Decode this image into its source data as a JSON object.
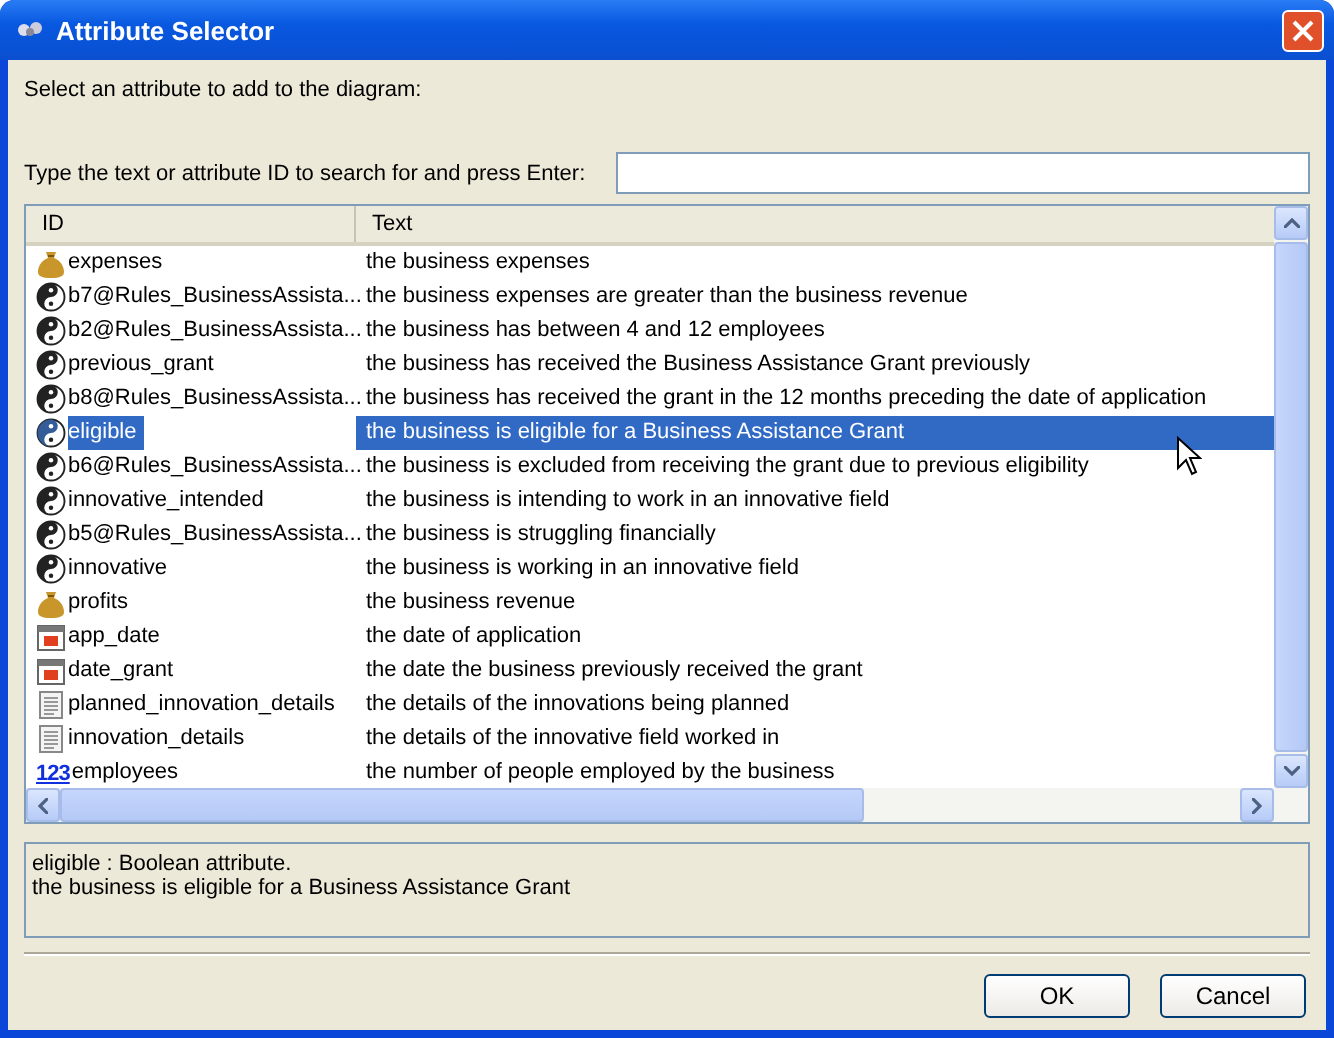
{
  "window": {
    "title": "Attribute Selector"
  },
  "instruction": "Select an attribute to add to the diagram:",
  "search": {
    "label": "Type the text or attribute ID to search for and press Enter:"
  },
  "table": {
    "columns": [
      "ID",
      "Text"
    ],
    "rows": [
      {
        "kind": "currency",
        "id": "expenses",
        "text": "the business expenses",
        "selected": false
      },
      {
        "kind": "boolean",
        "id": "b7@Rules_BusinessAssista...",
        "text": "the business expenses are greater than the business revenue",
        "selected": false
      },
      {
        "kind": "boolean",
        "id": "b2@Rules_BusinessAssista...",
        "text": "the business has between 4 and 12 employees",
        "selected": false
      },
      {
        "kind": "boolean",
        "id": "previous_grant",
        "text": "the business has received the Business Assistance Grant previously",
        "selected": false
      },
      {
        "kind": "boolean",
        "id": "b8@Rules_BusinessAssista...",
        "text": "the business has received the grant in the 12 months preceding the date of application",
        "selected": false
      },
      {
        "kind": "boolean",
        "id": "eligible",
        "text": "the business is eligible for a Business Assistance Grant",
        "selected": true
      },
      {
        "kind": "boolean",
        "id": "b6@Rules_BusinessAssista...",
        "text": "the business is excluded from receiving the grant due to previous eligibility",
        "selected": false
      },
      {
        "kind": "boolean",
        "id": "innovative_intended",
        "text": "the business is intending to work in an innovative field",
        "selected": false
      },
      {
        "kind": "boolean",
        "id": "b5@Rules_BusinessAssista...",
        "text": "the business is struggling financially",
        "selected": false
      },
      {
        "kind": "boolean",
        "id": "innovative",
        "text": "the business is working in an innovative field",
        "selected": false
      },
      {
        "kind": "currency",
        "id": "profits",
        "text": "the business revenue",
        "selected": false
      },
      {
        "kind": "date",
        "id": "app_date",
        "text": "the date of application",
        "selected": false
      },
      {
        "kind": "date",
        "id": "date_grant",
        "text": "the date the business previously received the grant",
        "selected": false
      },
      {
        "kind": "text",
        "id": "planned_innovation_details",
        "text": "the details of the innovations being planned",
        "selected": false
      },
      {
        "kind": "text",
        "id": "innovation_details",
        "text": "the details of the innovative field worked in",
        "selected": false
      },
      {
        "kind": "number",
        "icon_label": "123",
        "id": "employees",
        "text": "the number of people employed by the business",
        "selected": false
      }
    ]
  },
  "description": [
    "eligible : Boolean attribute.",
    "the business is eligible for a Business Assistance Grant"
  ],
  "buttons": [
    "OK",
    "Cancel"
  ]
}
